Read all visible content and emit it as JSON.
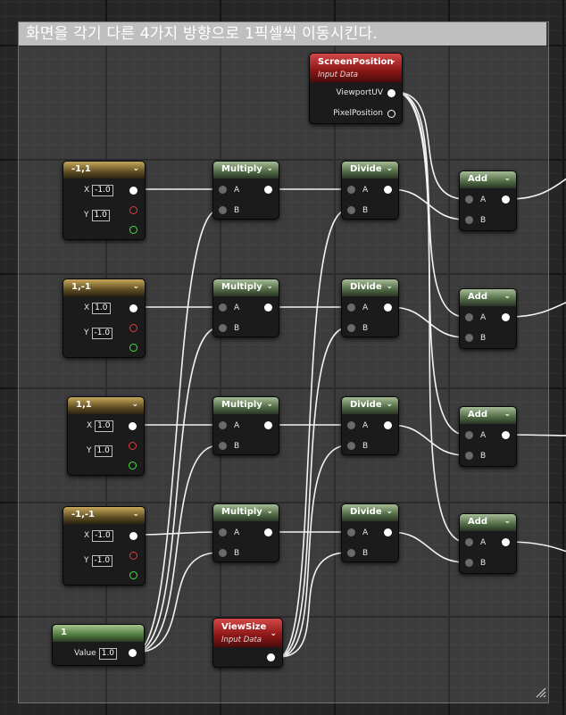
{
  "comment": {
    "title": "화면을 각기 다른 4가지 방향으로 1픽셀씩 이동시킨다."
  },
  "screen_position": {
    "title": "ScreenPosition",
    "subtitle": "Input Data",
    "out_viewport": "ViewportUV",
    "out_pixel": "PixelPosition"
  },
  "view_size": {
    "title": "ViewSize",
    "subtitle": "Input Data"
  },
  "scalar": {
    "title": "1",
    "label": "Value",
    "value": "1.0"
  },
  "constants": [
    {
      "title": "-1,1",
      "x": "-1.0",
      "y": "1.0"
    },
    {
      "title": "1,-1",
      "x": "1.0",
      "y": "-1.0"
    },
    {
      "title": "1,1",
      "x": "1.0",
      "y": "1.0"
    },
    {
      "title": "-1,-1",
      "x": "-1.0",
      "y": "-1.0"
    }
  ],
  "pins": {
    "x": "X",
    "y": "Y",
    "a": "A",
    "b": "B"
  },
  "multiply": {
    "title": "Multiply"
  },
  "divide": {
    "title": "Divide"
  },
  "add": {
    "title": "Add"
  }
}
